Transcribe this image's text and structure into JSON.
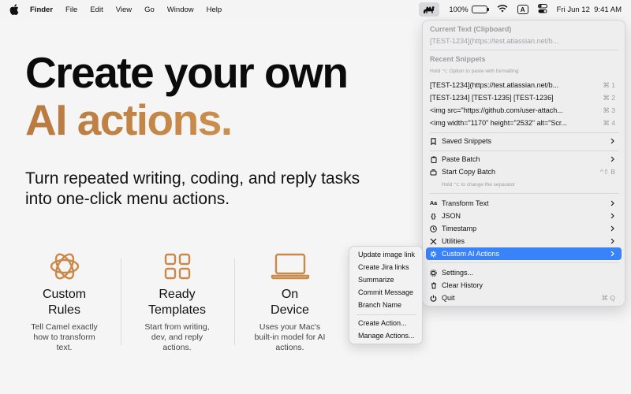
{
  "menubar": {
    "app_name": "Finder",
    "menus": [
      "File",
      "Edit",
      "View",
      "Go",
      "Window",
      "Help"
    ],
    "battery_percent": "100%",
    "battery_level": 1.0,
    "keyboard_indicator": "A",
    "datetime": "Fri Jun 12  9:41 AM",
    "icons": [
      "apple-icon",
      "camel-icon",
      "battery-icon",
      "wifi-icon",
      "keyboard-icon",
      "control-center-icon"
    ]
  },
  "hero": {
    "line1": "Create your own",
    "line2": "AI actions.",
    "subtitle": "Turn repeated writing, coding, and reply tasks into one-click menu actions.",
    "accent_color": "#c9894a"
  },
  "features": [
    {
      "title": "Custom\nRules",
      "description": "Tell Camel exactly how to transform text.",
      "icon": "flower-icon"
    },
    {
      "title": "Ready\nTemplates",
      "description": "Start from writing, dev, and reply actions.",
      "icon": "grid-icon"
    },
    {
      "title": "On\nDevice",
      "description": "Uses your Mac's built-in model for AI actions.",
      "icon": "laptop-icon"
    }
  ],
  "dropdown": {
    "current_label": "Current Text (Clipboard)",
    "current_value": "[TEST-1234](https://test.atlassian.net/b...",
    "recent_label": "Recent Snippets",
    "recent_hint": "Hold ⌥ Option to paste with formatting",
    "recent": [
      {
        "text": "[TEST-1234](https://test.atlassian.net/b...",
        "shortcut": "⌘ 1"
      },
      {
        "text": "[TEST-1234] [TEST-1235] [TEST-1236]",
        "shortcut": "⌘ 2"
      },
      {
        "text": "<img src=\"https://github.com/user-attach...",
        "shortcut": "⌘ 3"
      },
      {
        "text": "<img width=\"1170\" height=\"2532\" alt=\"Scr...",
        "shortcut": "⌘ 4"
      }
    ],
    "saved_snippets": "Saved Snippets",
    "paste_batch": "Paste Batch",
    "start_copy_batch": "Start Copy Batch",
    "start_copy_batch_shortcut": "^⇧ B",
    "batch_hint": "Hold ⌥ to change the separator",
    "transform_text": "Transform Text",
    "json": "JSON",
    "timestamp": "Timestamp",
    "utilities": "Utilities",
    "custom_ai_actions": "Custom AI Actions",
    "settings": "Settings...",
    "clear_history": "Clear History",
    "quit": "Quit",
    "quit_shortcut": "⌘ Q",
    "highlight_color": "#3a82f7"
  },
  "submenu": {
    "items": [
      "Update image link",
      "Create Jira links",
      "Summarize",
      "Commit Message",
      "Branch Name"
    ],
    "create_action": "Create Action...",
    "manage_actions": "Manage Actions..."
  }
}
